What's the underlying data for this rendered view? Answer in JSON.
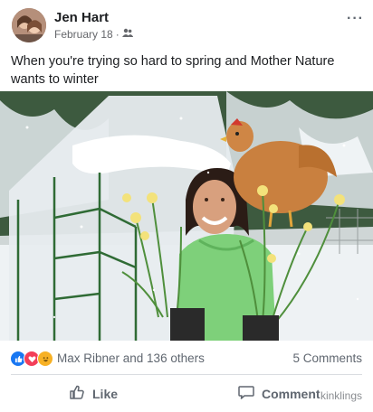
{
  "post": {
    "author": "Jen Hart",
    "date": "February 18",
    "separator": "·",
    "audience_icon": "friends-icon",
    "more_label": "···",
    "text": "When you're trying so hard to spring and Mother Nature wants to winter"
  },
  "photo": {
    "colors": {
      "snow": "#e9eef2",
      "hoodie": "#7ed07a",
      "hen": "#c9803f",
      "frame": "#2f6b35"
    }
  },
  "reactions": {
    "icons": [
      "like-reaction-icon",
      "love-reaction-icon",
      "haha-reaction-icon"
    ],
    "summary": "Max Ribner and 136 others",
    "comments": "5 Comments"
  },
  "actions": {
    "like_label": "Like",
    "comment_label": "Comment"
  },
  "watermark": "kinklings",
  "colors": {
    "like_blue": "#1877f2",
    "love_red": "#f33e58",
    "haha_yellow": "#f7b125"
  }
}
